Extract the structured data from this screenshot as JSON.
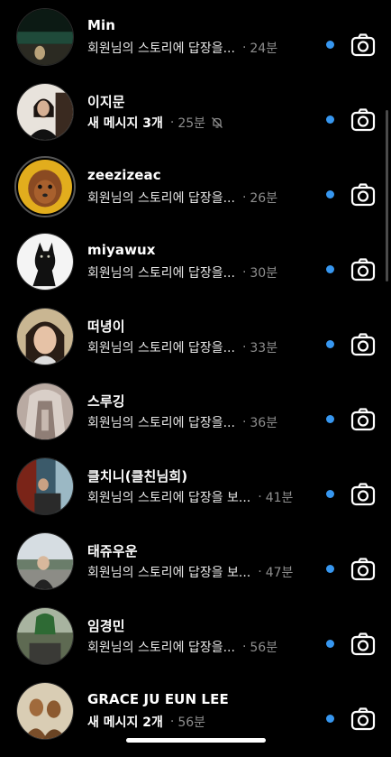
{
  "conversations": [
    {
      "name": "Min",
      "message": "회원님의 스토리에 답장을...",
      "time": "24분",
      "bold": false,
      "muted": false,
      "unread": true
    },
    {
      "name": "이지문",
      "message": "새 메시지 3개",
      "time": "25분",
      "bold": true,
      "muted": true,
      "unread": true
    },
    {
      "name": "zeezizeac",
      "message": "회원님의 스토리에 답장을...",
      "time": "26분",
      "bold": false,
      "muted": false,
      "unread": true
    },
    {
      "name": "miyawux",
      "message": "회원님의 스토리에 답장을...",
      "time": "30분",
      "bold": false,
      "muted": false,
      "unread": true
    },
    {
      "name": "떠녕이",
      "message": "회원님의 스토리에 답장을...",
      "time": "33분",
      "bold": false,
      "muted": false,
      "unread": true
    },
    {
      "name": "스루깅",
      "message": "회원님의 스토리에 답장을...",
      "time": "36분",
      "bold": false,
      "muted": false,
      "unread": true
    },
    {
      "name": "클치니(클친님희)",
      "message": "회원님의 스토리에 답장을 보...",
      "time": "41분",
      "bold": false,
      "muted": false,
      "unread": true
    },
    {
      "name": "태쥬우운",
      "message": "회원님의 스토리에 답장을 보...",
      "time": "47분",
      "bold": false,
      "muted": false,
      "unread": true
    },
    {
      "name": "임경민",
      "message": "회원님의 스토리에 답장을...",
      "time": "56분",
      "bold": false,
      "muted": false,
      "unread": true
    },
    {
      "name": "GRACE JU EUN LEE",
      "message": "새 메시지 2개",
      "time": "56분",
      "bold": true,
      "muted": false,
      "unread": true
    }
  ],
  "separator": "·",
  "colors": {
    "background": "#000000",
    "unread_dot": "#3797f0",
    "secondary_text": "#8e8e8e"
  },
  "icons": {
    "row_action": "camera-icon",
    "muted": "bell-off-icon"
  }
}
